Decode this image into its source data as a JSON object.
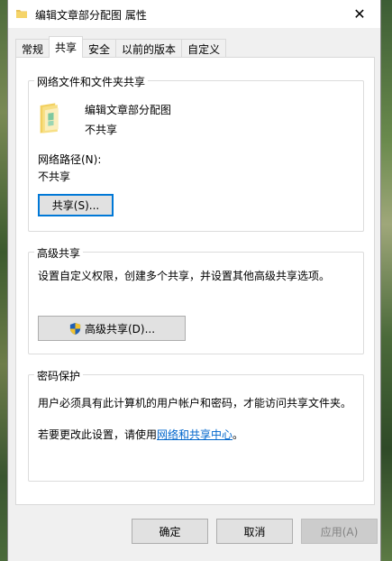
{
  "window": {
    "title": "编辑文章部分配图 属性",
    "close_label": "✕"
  },
  "tabs": [
    {
      "label": "常规",
      "active": false
    },
    {
      "label": "共享",
      "active": true
    },
    {
      "label": "安全",
      "active": false
    },
    {
      "label": "以前的版本",
      "active": false
    },
    {
      "label": "自定义",
      "active": false
    }
  ],
  "network_sharing": {
    "group_label": "网络文件和文件夹共享",
    "folder_name": "编辑文章部分配图",
    "folder_status": "不共享",
    "network_path_label": "网络路径(N):",
    "network_path_value": "不共享",
    "share_button": "共享(S)..."
  },
  "advanced_sharing": {
    "group_label": "高级共享",
    "description": "设置自定义权限，创建多个共享，并设置其他高级共享选项。",
    "button": "高级共享(D)..."
  },
  "password_protection": {
    "group_label": "密码保护",
    "description": "用户必须具有此计算机的用户帐户和密码，才能访问共享文件夹。",
    "change_text": "若要更改此设置，请使用",
    "link_text": "网络和共享中心",
    "trailing": "。"
  },
  "footer": {
    "ok": "确定",
    "cancel": "取消",
    "apply": "应用(A)"
  },
  "icons": {
    "title_icon": "folder-icon",
    "folder_icon": "shared-folder-icon",
    "shield_icon": "uac-shield-icon",
    "close_icon": "close-icon"
  }
}
